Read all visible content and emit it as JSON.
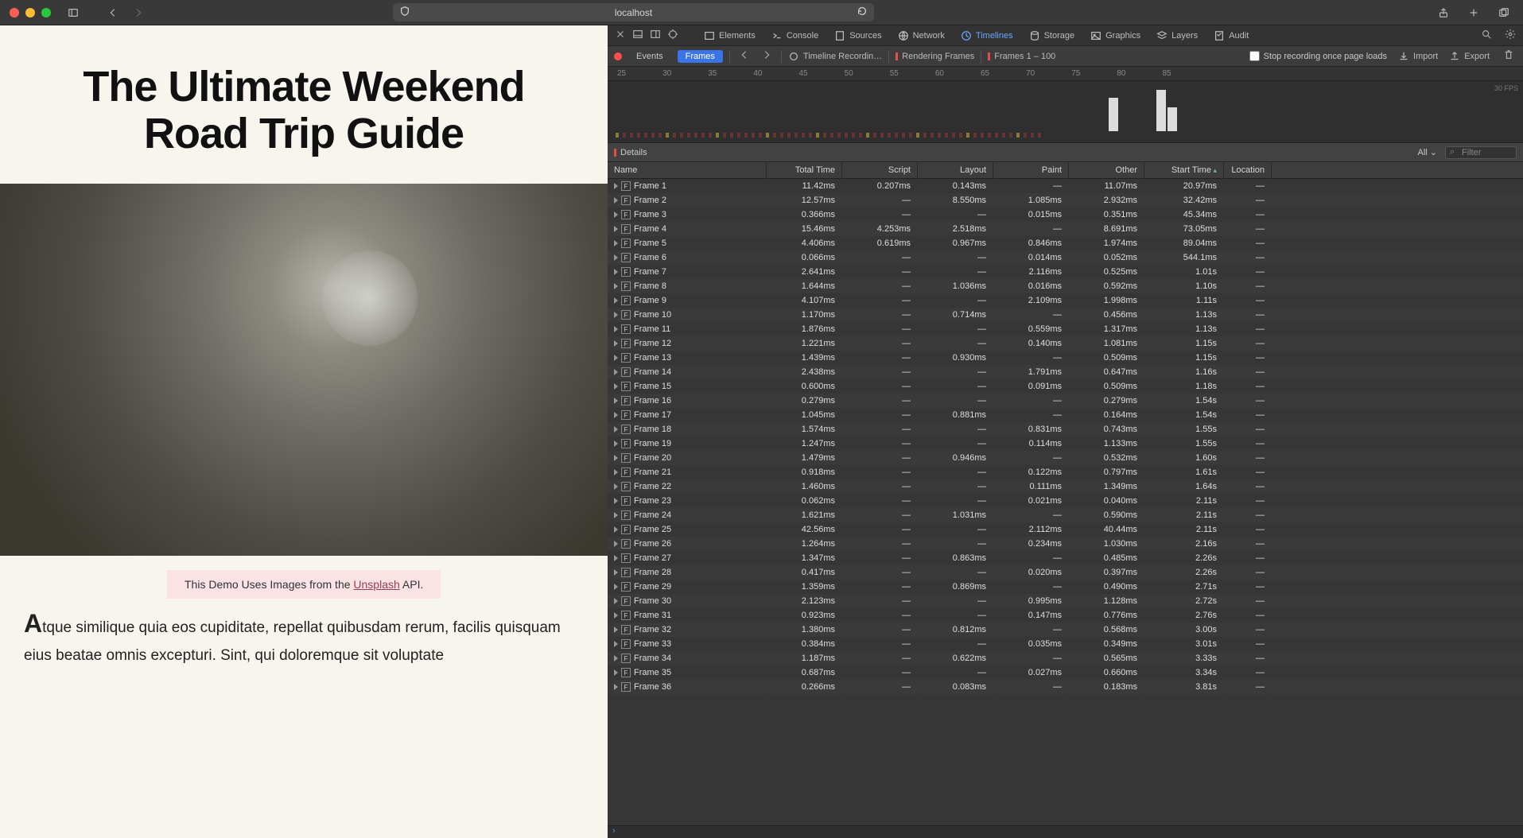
{
  "titlebar": {
    "address": "localhost"
  },
  "page": {
    "title": "The Ultimate Weekend Road Trip Guide",
    "caption_prefix": "This Demo Uses Images from the ",
    "caption_link": "Unsplash",
    "caption_suffix": " API.",
    "body": "Atque similique quia eos cupiditate, repellat quibusdam rerum, facilis quisquam eius beatae omnis excepturi. Sint, qui doloremque sit voluptate"
  },
  "devtools": {
    "tabs": {
      "elements": "Elements",
      "console": "Console",
      "sources": "Sources",
      "network": "Network",
      "timelines": "Timelines",
      "storage": "Storage",
      "graphics": "Graphics",
      "layers": "Layers",
      "audit": "Audit"
    },
    "toolbar": {
      "events": "Events",
      "frames": "Frames",
      "recording": "Timeline Recordin…",
      "rendering": "Rendering Frames",
      "range": "Frames 1 – 100",
      "stoponload": "Stop recording once page loads",
      "import": "Import",
      "export": "Export"
    },
    "ruler": [
      "25",
      "30",
      "35",
      "40",
      "45",
      "50",
      "55",
      "60",
      "65",
      "70",
      "75",
      "80",
      "85"
    ],
    "fps_label": "30 FPS",
    "details_label": "Details",
    "all_label": "All",
    "filter_placeholder": "Filter",
    "columns": [
      "Name",
      "Total Time",
      "Script",
      "Layout",
      "Paint",
      "Other",
      "Start Time",
      "Location"
    ],
    "frames": [
      {
        "n": 1,
        "total": "11.42ms",
        "script": "0.207ms",
        "layout": "0.143ms",
        "paint": "—",
        "other": "11.07ms",
        "start": "20.97ms",
        "loc": "—"
      },
      {
        "n": 2,
        "total": "12.57ms",
        "script": "—",
        "layout": "8.550ms",
        "paint": "1.085ms",
        "other": "2.932ms",
        "start": "32.42ms",
        "loc": "—"
      },
      {
        "n": 3,
        "total": "0.366ms",
        "script": "—",
        "layout": "—",
        "paint": "0.015ms",
        "other": "0.351ms",
        "start": "45.34ms",
        "loc": "—"
      },
      {
        "n": 4,
        "total": "15.46ms",
        "script": "4.253ms",
        "layout": "2.518ms",
        "paint": "—",
        "other": "8.691ms",
        "start": "73.05ms",
        "loc": "—"
      },
      {
        "n": 5,
        "total": "4.406ms",
        "script": "0.619ms",
        "layout": "0.967ms",
        "paint": "0.846ms",
        "other": "1.974ms",
        "start": "89.04ms",
        "loc": "—"
      },
      {
        "n": 6,
        "total": "0.066ms",
        "script": "—",
        "layout": "—",
        "paint": "0.014ms",
        "other": "0.052ms",
        "start": "544.1ms",
        "loc": "—"
      },
      {
        "n": 7,
        "total": "2.641ms",
        "script": "—",
        "layout": "—",
        "paint": "2.116ms",
        "other": "0.525ms",
        "start": "1.01s",
        "loc": "—"
      },
      {
        "n": 8,
        "total": "1.644ms",
        "script": "—",
        "layout": "1.036ms",
        "paint": "0.016ms",
        "other": "0.592ms",
        "start": "1.10s",
        "loc": "—"
      },
      {
        "n": 9,
        "total": "4.107ms",
        "script": "—",
        "layout": "—",
        "paint": "2.109ms",
        "other": "1.998ms",
        "start": "1.11s",
        "loc": "—"
      },
      {
        "n": 10,
        "total": "1.170ms",
        "script": "—",
        "layout": "0.714ms",
        "paint": "—",
        "other": "0.456ms",
        "start": "1.13s",
        "loc": "—"
      },
      {
        "n": 11,
        "total": "1.876ms",
        "script": "—",
        "layout": "—",
        "paint": "0.559ms",
        "other": "1.317ms",
        "start": "1.13s",
        "loc": "—"
      },
      {
        "n": 12,
        "total": "1.221ms",
        "script": "—",
        "layout": "—",
        "paint": "0.140ms",
        "other": "1.081ms",
        "start": "1.15s",
        "loc": "—"
      },
      {
        "n": 13,
        "total": "1.439ms",
        "script": "—",
        "layout": "0.930ms",
        "paint": "—",
        "other": "0.509ms",
        "start": "1.15s",
        "loc": "—"
      },
      {
        "n": 14,
        "total": "2.438ms",
        "script": "—",
        "layout": "—",
        "paint": "1.791ms",
        "other": "0.647ms",
        "start": "1.16s",
        "loc": "—"
      },
      {
        "n": 15,
        "total": "0.600ms",
        "script": "—",
        "layout": "—",
        "paint": "0.091ms",
        "other": "0.509ms",
        "start": "1.18s",
        "loc": "—"
      },
      {
        "n": 16,
        "total": "0.279ms",
        "script": "—",
        "layout": "—",
        "paint": "—",
        "other": "0.279ms",
        "start": "1.54s",
        "loc": "—"
      },
      {
        "n": 17,
        "total": "1.045ms",
        "script": "—",
        "layout": "0.881ms",
        "paint": "—",
        "other": "0.164ms",
        "start": "1.54s",
        "loc": "—"
      },
      {
        "n": 18,
        "total": "1.574ms",
        "script": "—",
        "layout": "—",
        "paint": "0.831ms",
        "other": "0.743ms",
        "start": "1.55s",
        "loc": "—"
      },
      {
        "n": 19,
        "total": "1.247ms",
        "script": "—",
        "layout": "—",
        "paint": "0.114ms",
        "other": "1.133ms",
        "start": "1.55s",
        "loc": "—"
      },
      {
        "n": 20,
        "total": "1.479ms",
        "script": "—",
        "layout": "0.946ms",
        "paint": "—",
        "other": "0.532ms",
        "start": "1.60s",
        "loc": "—"
      },
      {
        "n": 21,
        "total": "0.918ms",
        "script": "—",
        "layout": "—",
        "paint": "0.122ms",
        "other": "0.797ms",
        "start": "1.61s",
        "loc": "—"
      },
      {
        "n": 22,
        "total": "1.460ms",
        "script": "—",
        "layout": "—",
        "paint": "0.111ms",
        "other": "1.349ms",
        "start": "1.64s",
        "loc": "—"
      },
      {
        "n": 23,
        "total": "0.062ms",
        "script": "—",
        "layout": "—",
        "paint": "0.021ms",
        "other": "0.040ms",
        "start": "2.11s",
        "loc": "—"
      },
      {
        "n": 24,
        "total": "1.621ms",
        "script": "—",
        "layout": "1.031ms",
        "paint": "—",
        "other": "0.590ms",
        "start": "2.11s",
        "loc": "—"
      },
      {
        "n": 25,
        "total": "42.56ms",
        "script": "—",
        "layout": "—",
        "paint": "2.112ms",
        "other": "40.44ms",
        "start": "2.11s",
        "loc": "—"
      },
      {
        "n": 26,
        "total": "1.264ms",
        "script": "—",
        "layout": "—",
        "paint": "0.234ms",
        "other": "1.030ms",
        "start": "2.16s",
        "loc": "—"
      },
      {
        "n": 27,
        "total": "1.347ms",
        "script": "—",
        "layout": "0.863ms",
        "paint": "—",
        "other": "0.485ms",
        "start": "2.26s",
        "loc": "—"
      },
      {
        "n": 28,
        "total": "0.417ms",
        "script": "—",
        "layout": "—",
        "paint": "0.020ms",
        "other": "0.397ms",
        "start": "2.26s",
        "loc": "—"
      },
      {
        "n": 29,
        "total": "1.359ms",
        "script": "—",
        "layout": "0.869ms",
        "paint": "—",
        "other": "0.490ms",
        "start": "2.71s",
        "loc": "—"
      },
      {
        "n": 30,
        "total": "2.123ms",
        "script": "—",
        "layout": "—",
        "paint": "0.995ms",
        "other": "1.128ms",
        "start": "2.72s",
        "loc": "—"
      },
      {
        "n": 31,
        "total": "0.923ms",
        "script": "—",
        "layout": "—",
        "paint": "0.147ms",
        "other": "0.776ms",
        "start": "2.76s",
        "loc": "—"
      },
      {
        "n": 32,
        "total": "1.380ms",
        "script": "—",
        "layout": "0.812ms",
        "paint": "—",
        "other": "0.568ms",
        "start": "3.00s",
        "loc": "—"
      },
      {
        "n": 33,
        "total": "0.384ms",
        "script": "—",
        "layout": "—",
        "paint": "0.035ms",
        "other": "0.349ms",
        "start": "3.01s",
        "loc": "—"
      },
      {
        "n": 34,
        "total": "1.187ms",
        "script": "—",
        "layout": "0.622ms",
        "paint": "—",
        "other": "0.565ms",
        "start": "3.33s",
        "loc": "—"
      },
      {
        "n": 35,
        "total": "0.687ms",
        "script": "—",
        "layout": "—",
        "paint": "0.027ms",
        "other": "0.660ms",
        "start": "3.34s",
        "loc": "—"
      },
      {
        "n": 36,
        "total": "0.266ms",
        "script": "—",
        "layout": "0.083ms",
        "paint": "—",
        "other": "0.183ms",
        "start": "3.81s",
        "loc": "—"
      }
    ]
  }
}
